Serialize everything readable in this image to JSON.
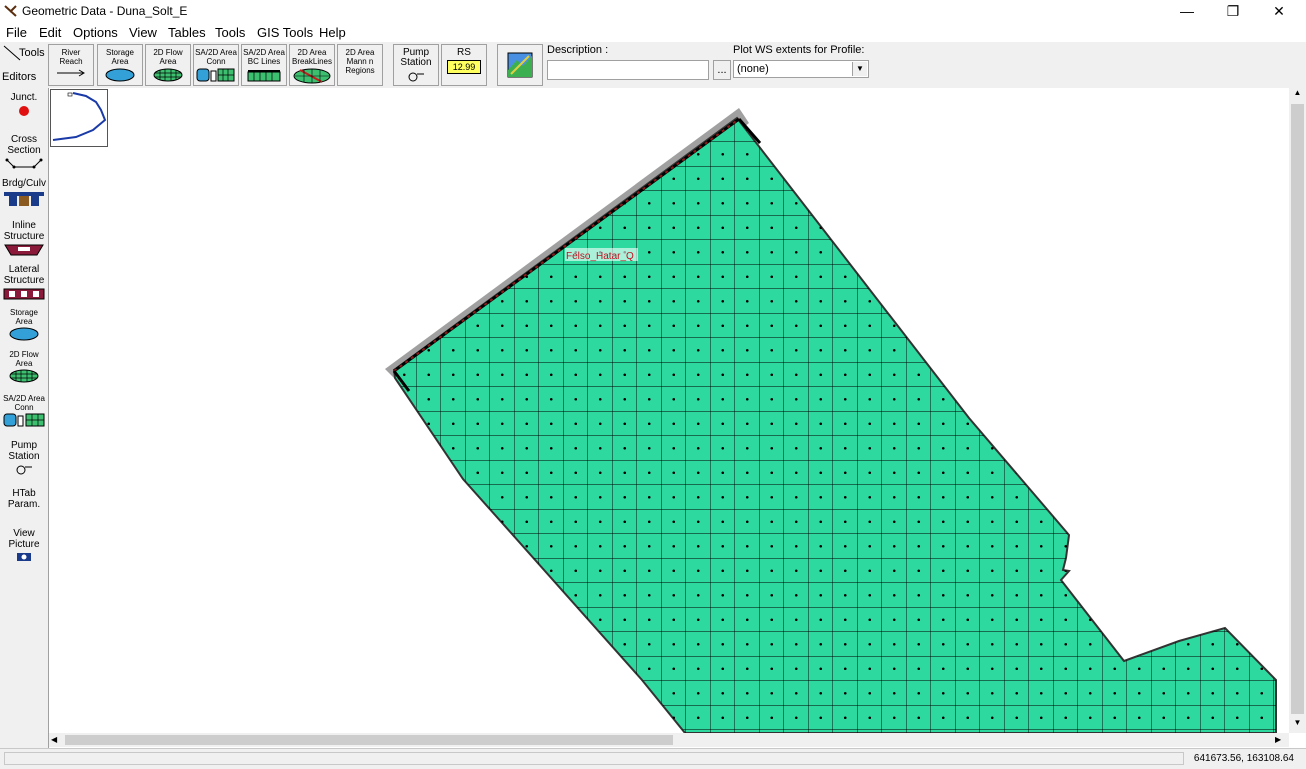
{
  "window": {
    "title": "Geometric Data - Duna_Solt_E",
    "minimize_glyph": "—",
    "maximize_glyph": "❐",
    "close_glyph": "✕"
  },
  "menu": {
    "file": "File",
    "edit": "Edit",
    "options": "Options",
    "view": "View",
    "tables": "Tables",
    "tools": "Tools",
    "gis_tools": "GIS Tools",
    "help": "Help"
  },
  "toolbar": {
    "tools_label": "Tools",
    "editors_label": "Editors",
    "buttons": [
      {
        "line1": "River",
        "line2": "Reach"
      },
      {
        "line1": "Storage",
        "line2": "Area"
      },
      {
        "line1": "2D Flow",
        "line2": "Area"
      },
      {
        "line1": "SA/2D Area",
        "line2": "Conn"
      },
      {
        "line1": "SA/2D Area",
        "line2": "BC Lines"
      },
      {
        "line1": "2D Area",
        "line2": "BreakLines"
      },
      {
        "line1": "2D Area",
        "line2": "Mann n",
        "line3": "Regions"
      },
      {
        "line1": "Pump",
        "line2": "Station"
      },
      {
        "line1": "RS",
        "line2": "12.99"
      }
    ],
    "description_label": "Description :",
    "description_value": "",
    "ellipsis_label": "...",
    "plot_ws_label": "Plot WS extents for Profile:",
    "plot_ws_value": "(none)"
  },
  "editors": [
    {
      "line1": "Junct.",
      "line2": ""
    },
    {
      "line1": "Cross",
      "line2": "Section"
    },
    {
      "line1": "Brdg/Culv",
      "line2": ""
    },
    {
      "line1": "Inline",
      "line2": "Structure"
    },
    {
      "line1": "Lateral",
      "line2": "Structure"
    },
    {
      "line1": "Storage",
      "line2": "Area"
    },
    {
      "line1": "2D Flow",
      "line2": "Area"
    },
    {
      "line1": "SA/2D Area",
      "line2": "Conn"
    },
    {
      "line1": "Pump",
      "line2": "Station"
    },
    {
      "line1": "HTab",
      "line2": "Param."
    },
    {
      "line1": "View",
      "line2": "Picture"
    }
  ],
  "map": {
    "bc_line_label": "Felso_Hatar_Q",
    "flow_area_color": "#2ed9a0",
    "bc_line_color": "#8b1a1a"
  },
  "status": {
    "coordinates": "641673.56, 163108.64"
  }
}
